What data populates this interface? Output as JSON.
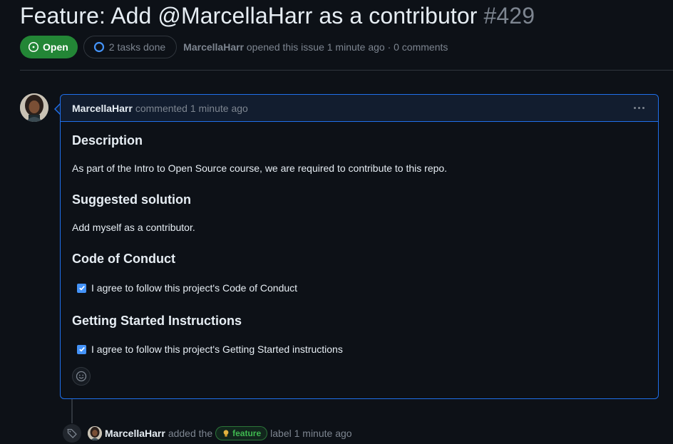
{
  "issue": {
    "title": "Feature: Add @MarcellaHarr as a contributor",
    "number": "#429",
    "state": "Open",
    "tasks": "2 tasks done",
    "author": "MarcellaHarr",
    "opened_text": "opened this issue 1 minute ago · 0 comments"
  },
  "comment": {
    "author": "MarcellaHarr",
    "action": "commented 1 minute ago",
    "sections": [
      {
        "heading": "Description",
        "text": "As part of the Intro to Open Source course, we are required to contribute to this repo."
      },
      {
        "heading": "Suggested solution",
        "text": "Add myself as a contributor."
      },
      {
        "heading": "Code of Conduct",
        "check": "I agree to follow this project's Code of Conduct"
      },
      {
        "heading": "Getting Started Instructions",
        "check": "I agree to follow this project's Getting Started instructions"
      }
    ]
  },
  "event": {
    "author": "MarcellaHarr",
    "added_text": "added the",
    "label": "feature",
    "label_suffix": "label 1 minute ago"
  },
  "colors": {
    "open_badge": "#238636",
    "accent_border": "#1f6feb",
    "checkbox": "#4493f8",
    "label_green": "#3fb950"
  }
}
